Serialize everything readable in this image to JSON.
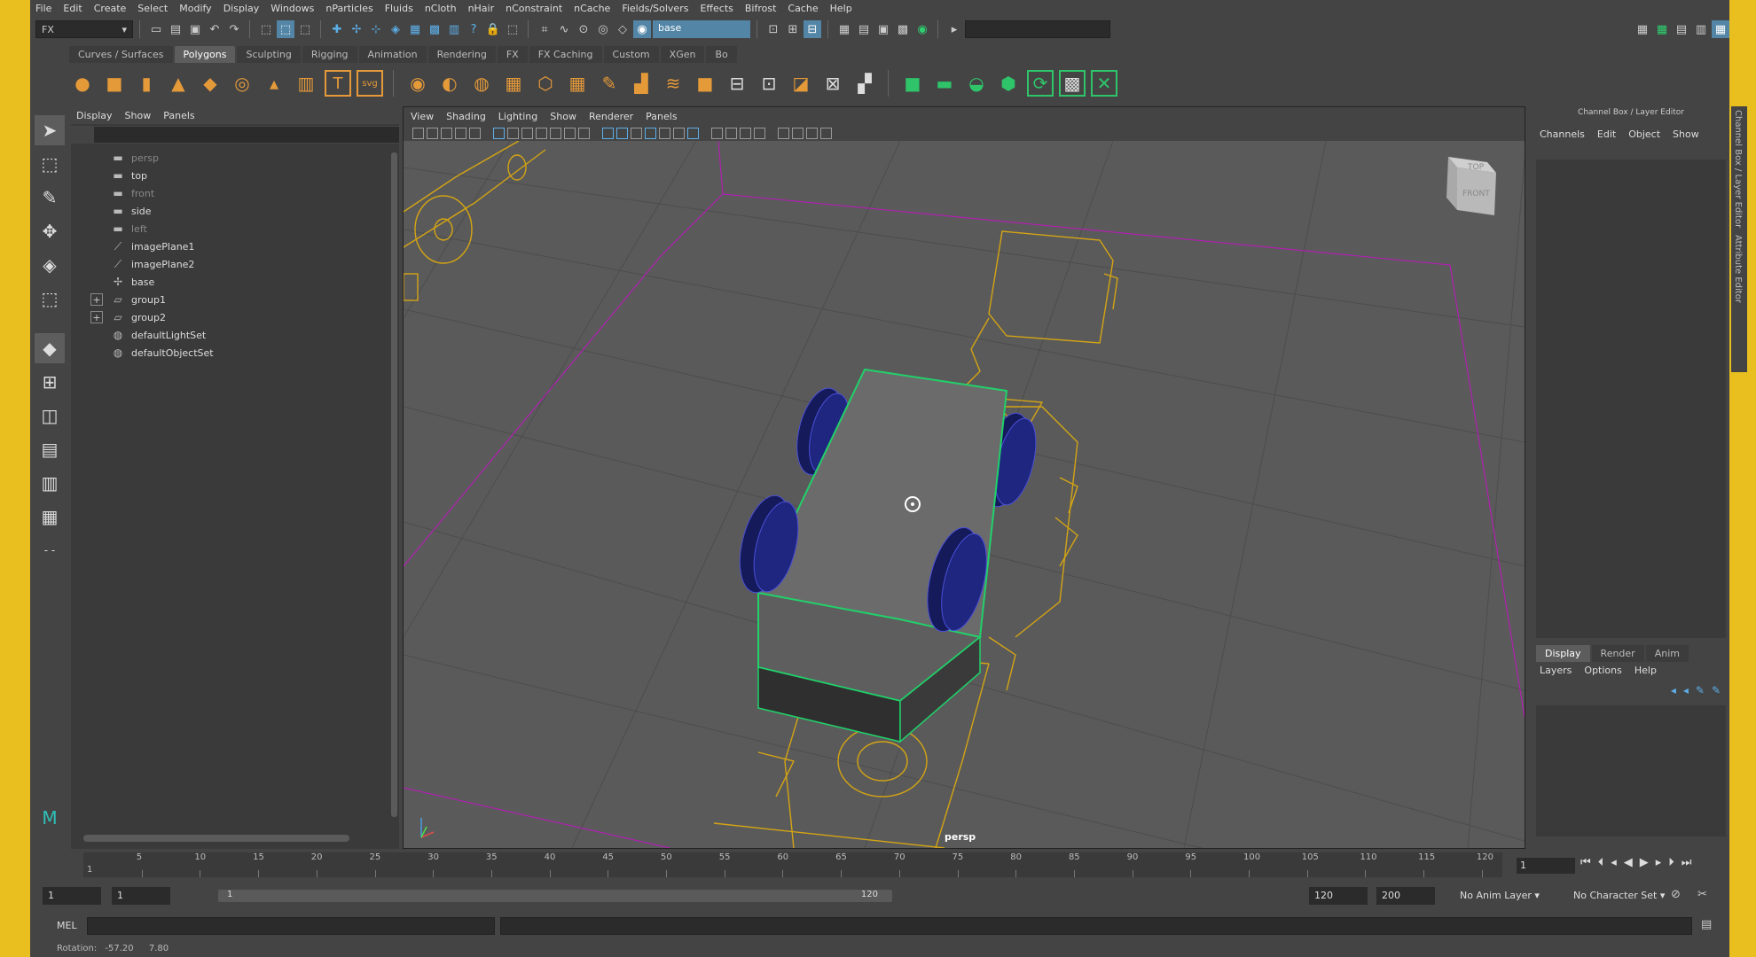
{
  "menubar": [
    "File",
    "Edit",
    "Create",
    "Select",
    "Modify",
    "Display",
    "Windows",
    "nParticles",
    "Fluids",
    "nCloth",
    "nHair",
    "nConstraint",
    "nCache",
    "Fields/Solvers",
    "Effects",
    "Bifrost",
    "Cache",
    "Help"
  ],
  "status": {
    "mode": "FX",
    "object_field": "base"
  },
  "shelf_tabs": [
    "Curves / Surfaces",
    "Polygons",
    "Sculpting",
    "Rigging",
    "Animation",
    "Rendering",
    "FX",
    "FX Caching",
    "Custom",
    "XGen",
    "Bo"
  ],
  "active_shelf": "Polygons",
  "outliner": {
    "menu": [
      "Display",
      "Show",
      "Panels"
    ],
    "items": [
      {
        "label": "persp",
        "icon": "camera-icon",
        "dim": true,
        "expandable": false
      },
      {
        "label": "top",
        "icon": "camera-icon",
        "dim": false,
        "expandable": false
      },
      {
        "label": "front",
        "icon": "camera-icon",
        "dim": true,
        "expandable": false
      },
      {
        "label": "side",
        "icon": "camera-icon",
        "dim": false,
        "expandable": false
      },
      {
        "label": "left",
        "icon": "camera-icon",
        "dim": true,
        "expandable": false
      },
      {
        "label": "imagePlane1",
        "icon": "imageplane-icon",
        "dim": false,
        "expandable": false
      },
      {
        "label": "imagePlane2",
        "icon": "imageplane-icon",
        "dim": false,
        "expandable": false
      },
      {
        "label": "base",
        "icon": "mesh-icon",
        "dim": false,
        "expandable": false
      },
      {
        "label": "group1",
        "icon": "group-icon",
        "dim": false,
        "expandable": true
      },
      {
        "label": "group2",
        "icon": "group-icon",
        "dim": false,
        "expandable": true
      },
      {
        "label": "defaultLightSet",
        "icon": "set-icon",
        "dim": false,
        "expandable": false
      },
      {
        "label": "defaultObjectSet",
        "icon": "set-icon",
        "dim": false,
        "expandable": false
      }
    ]
  },
  "viewport": {
    "menu": [
      "View",
      "Shading",
      "Lighting",
      "Show",
      "Renderer",
      "Panels"
    ],
    "camera_label": "persp",
    "viewcube_top": "TOP",
    "viewcube_front": "FRONT"
  },
  "channel_box": {
    "title": "Channel Box / Layer Editor",
    "menu": [
      "Channels",
      "Edit",
      "Object",
      "Show"
    ]
  },
  "layer_editor": {
    "tabs": [
      "Display",
      "Render",
      "Anim"
    ],
    "active_tab": "Display",
    "menu": [
      "Layers",
      "Options",
      "Help"
    ]
  },
  "side_tabs": [
    "Channel Box / Layer Editor",
    "Attribute Editor"
  ],
  "timeline": {
    "ticks": [
      "5",
      "10",
      "15",
      "20",
      "25",
      "30",
      "35",
      "40",
      "45",
      "50",
      "55",
      "60",
      "65",
      "70",
      "75",
      "80",
      "85",
      "90",
      "95",
      "100",
      "105",
      "110",
      "115",
      "120"
    ],
    "start_tick": "1",
    "current_frame": "1"
  },
  "range": {
    "start": "1",
    "playback_start": "1",
    "bar_start": "1",
    "bar_end": "120",
    "playback_end": "120",
    "end": "200",
    "anim_layer": "No Anim Layer",
    "character_set": "No Character Set"
  },
  "command": {
    "label": "MEL"
  },
  "help_line": {
    "label": "Rotation:",
    "v1": "-57.20",
    "v2": "7.80"
  }
}
